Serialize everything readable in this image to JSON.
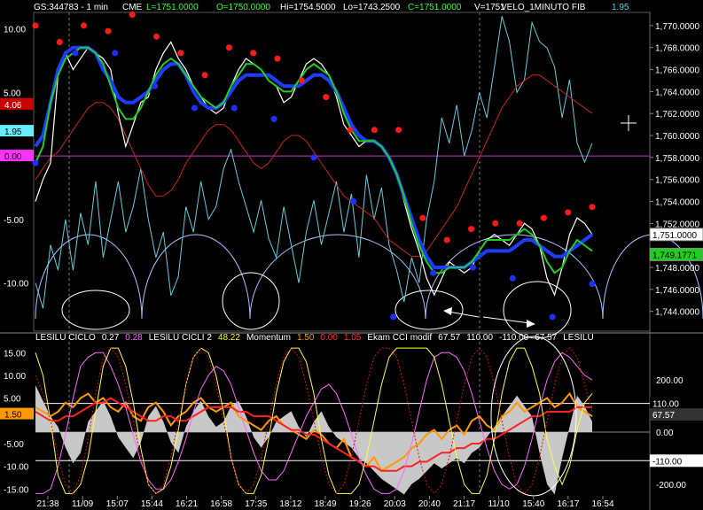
{
  "header": {
    "symbol": "GS:344783 - 1 min",
    "exchange": "CME",
    "last": "L=1751.0000",
    "open": "O=1750.0000",
    "high": "Hi=1754.5000",
    "low": "Lo=1743.2500",
    "close": "C=1751.0000",
    "volume": "V=1751",
    "study": "VELO_1MINUTO FIB",
    "study_value": "1.95"
  },
  "lower_header": [
    {
      "text": "LESILU CICLO",
      "color": "#ffffff"
    },
    {
      "text": "0.27",
      "color": "#ffffff"
    },
    {
      "text": "0.28",
      "color": "#ff66ff"
    },
    {
      "text": "LESILU CICLI 2",
      "color": "#ffffff"
    },
    {
      "text": "48.22",
      "color": "#ffff00"
    },
    {
      "text": "Momentum",
      "color": "#ffffff"
    },
    {
      "text": "1.50",
      "color": "#ff9900"
    },
    {
      "text": "0.00",
      "color": "#ff3333"
    },
    {
      "text": "1.05",
      "color": "#ff3333"
    },
    {
      "text": "Ekam CCI modif",
      "color": "#ffffff"
    },
    {
      "text": "67.57",
      "color": "#ffffff"
    },
    {
      "text": "110.00",
      "color": "#ffffff"
    },
    {
      "text": "-110.00",
      "color": "#ffffff"
    },
    {
      "text": "67.57",
      "color": "#ffffff"
    },
    {
      "text": "LESILU",
      "color": "#ffffff"
    }
  ],
  "colors": {
    "background": "#000000",
    "price": "#ffffff",
    "velocity": "#66ccdd",
    "ma_blue": "#1e3cff",
    "ma_green": "#22cc22",
    "ma_red": "#cc2222",
    "top_dot": "#ff1a1a",
    "bottom_dot": "#1f2fff",
    "cycle_arc": "#aac4ff",
    "zero_line": "#cc33cc"
  },
  "chart_data": [
    {
      "type": "line",
      "panel": "price",
      "y_left_ticks": [
        "10.00",
        "5.00",
        "-5.00",
        "-10.00"
      ],
      "y_right_ticks": [
        "1,770.0000",
        "1,768.0000",
        "1,766.0000",
        "1,764.0000",
        "1,762.0000",
        "1,760.0000",
        "1,758.0000",
        "1,756.0000",
        "1,754.0000",
        "1,752.0000",
        "1,748.0000",
        "1,746.0000",
        "1,744.0000"
      ],
      "ylim_price": [
        1742.2,
        1771.2
      ],
      "ylim_osc": [
        -13.8,
        11.3
      ],
      "left_markers": [
        {
          "text": "4.06",
          "bg": "#cc0000",
          "fg": "#ffffff",
          "value": 4.06
        },
        {
          "text": "1.95",
          "bg": "#66eeff",
          "fg": "#000000",
          "value": 1.95
        },
        {
          "text": "0.00",
          "bg": "#ff33ff",
          "fg": "#000000",
          "value": 0.0
        }
      ],
      "right_markers": [
        {
          "text": "1,751.0000",
          "bg": "#ffffff",
          "fg": "#000000",
          "value": 1751.0
        },
        {
          "text": "1,749.1771",
          "bg": "#22cc22",
          "fg": "#000000",
          "value": 1749.1771
        }
      ],
      "price_series": [
        1754.0,
        1756.0,
        1757.5,
        1765.5,
        1767.5,
        1766.0,
        1767.0,
        1768.0,
        1767.5,
        1767.0,
        1766.0,
        1762.0,
        1759.0,
        1761.0,
        1763.0,
        1763.5,
        1766.0,
        1767.5,
        1768.5,
        1767.0,
        1766.0,
        1764.5,
        1763.5,
        1762.5,
        1762.0,
        1762.5,
        1764.5,
        1766.0,
        1767.0,
        1766.5,
        1766.0,
        1765.0,
        1764.5,
        1763.0,
        1763.5,
        1765.0,
        1766.5,
        1767.0,
        1766.5,
        1765.5,
        1763.5,
        1761.0,
        1760.0,
        1759.0,
        1759.5,
        1759.5,
        1759.0,
        1758.0,
        1756.5,
        1754.0,
        1751.5,
        1749.5,
        1747.0,
        1745.5,
        1747.0,
        1748.5,
        1748.0,
        1747.5,
        1748.0,
        1749.5,
        1750.5,
        1751.0,
        1750.5,
        1750.0,
        1751.0,
        1752.0,
        1751.5,
        1750.0,
        1747.0,
        1745.5,
        1748.0,
        1751.0,
        1752.5,
        1752.0,
        1751.0
      ],
      "series": [
        {
          "color": "#1e3cff",
          "values": [
            1759.0,
            1760.0,
            1763.0,
            1766.0,
            1767.5,
            1768.0,
            1768.0,
            1768.0,
            1767.5,
            1766.0,
            1765.0,
            1763.5,
            1763.0,
            1763.0,
            1763.5,
            1764.0,
            1765.0,
            1766.0,
            1766.5,
            1766.5,
            1765.5,
            1764.0,
            1763.0,
            1762.5,
            1762.5,
            1763.0,
            1764.0,
            1765.0,
            1765.5,
            1765.5,
            1765.5,
            1765.5,
            1765.0,
            1764.5,
            1764.5,
            1764.5,
            1765.0,
            1765.5,
            1765.5,
            1765.0,
            1764.0,
            1762.5,
            1761.0,
            1760.0,
            1759.5,
            1759.5,
            1759.0,
            1758.0,
            1756.5,
            1754.5,
            1752.5,
            1750.5,
            1749.0,
            1748.0,
            1748.0,
            1748.0,
            1748.0,
            1748.0,
            1748.5,
            1749.0,
            1749.5,
            1749.5,
            1749.5,
            1749.5,
            1750.0,
            1750.5,
            1750.5,
            1750.0,
            1749.5,
            1749.0,
            1749.0,
            1749.5,
            1750.0,
            1750.5,
            1751.0
          ]
        },
        {
          "color": "#22cc22",
          "values": [
            1757.5,
            1759.0,
            1763.0,
            1765.5,
            1767.0,
            1767.5,
            1768.0,
            1768.0,
            1767.5,
            1766.5,
            1764.5,
            1762.5,
            1761.5,
            1761.5,
            1762.5,
            1764.0,
            1765.5,
            1766.5,
            1767.0,
            1766.5,
            1765.5,
            1764.5,
            1763.5,
            1763.0,
            1762.5,
            1763.0,
            1764.5,
            1765.5,
            1766.5,
            1766.5,
            1766.0,
            1765.0,
            1764.5,
            1764.0,
            1764.0,
            1765.0,
            1766.0,
            1766.5,
            1766.0,
            1765.5,
            1764.0,
            1762.0,
            1760.5,
            1759.5,
            1759.5,
            1759.5,
            1759.0,
            1758.0,
            1756.5,
            1754.5,
            1752.0,
            1750.0,
            1748.5,
            1747.5,
            1747.5,
            1748.0,
            1748.0,
            1748.0,
            1748.5,
            1749.5,
            1750.5,
            1750.5,
            1750.5,
            1750.5,
            1751.0,
            1751.5,
            1751.0,
            1750.0,
            1748.5,
            1747.5,
            1748.0,
            1749.5,
            1750.5,
            1750.0,
            1749.5
          ]
        },
        {
          "color": "#cc2222",
          "values": [
            1756.0,
            1757.0,
            1758.0,
            1758.5,
            1759.5,
            1760.5,
            1761.5,
            1762.5,
            1763.0,
            1763.0,
            1762.5,
            1761.5,
            1760.0,
            1758.5,
            1757.0,
            1755.5,
            1754.5,
            1754.5,
            1755.0,
            1756.0,
            1757.5,
            1758.5,
            1759.5,
            1760.5,
            1761.0,
            1761.0,
            1760.5,
            1759.5,
            1758.5,
            1757.5,
            1757.0,
            1757.5,
            1758.5,
            1759.5,
            1760.0,
            1760.0,
            1759.5,
            1758.5,
            1757.5,
            1756.5,
            1755.5,
            1754.5,
            1754.0,
            1753.5,
            1753.0,
            1752.5,
            1751.5,
            1750.5,
            1750.0,
            1749.5,
            1749.0,
            1749.0,
            1749.5,
            1750.5,
            1751.5,
            1752.5,
            1753.5,
            1755.0,
            1756.5,
            1758.0,
            1759.5,
            1761.0,
            1762.5,
            1763.5,
            1764.5,
            1765.0,
            1765.5,
            1765.5,
            1765.0,
            1764.5,
            1764.0,
            1763.5,
            1763.0,
            1762.5,
            1762.0
          ]
        },
        {
          "color": "#66ccdd",
          "values": [
            -10.0,
            -12.0,
            -7.0,
            -9.0,
            -5.0,
            -9.0,
            -4.5,
            -7.0,
            -2.0,
            -8.0,
            -5.0,
            -2.0,
            -6.0,
            -4.0,
            -1.0,
            -5.0,
            -8.0,
            -6.0,
            -11.0,
            -9.5,
            -4.0,
            -6.0,
            -2.0,
            -5.0,
            -4.0,
            -1.0,
            0.5,
            -2.0,
            -4.0,
            -6.0,
            -3.5,
            -6.5,
            -8.0,
            -4.0,
            -7.0,
            -10.0,
            -6.0,
            -3.5,
            -7.0,
            -4.5,
            -2.0,
            -6.0,
            -3.0,
            -8.0,
            -1.5,
            -5.0,
            -2.5,
            -7.0,
            -9.0,
            -11.5,
            -8.0,
            -10.0,
            -5.0,
            -2.0,
            3.0,
            1.0,
            4.0,
            0.0,
            2.0,
            5.0,
            3.0,
            7.0,
            11.0,
            9.0,
            5.0,
            6.0,
            10.5,
            9.0,
            8.5,
            7.0,
            3.0,
            6.0,
            1.0,
            -0.5,
            1.0
          ]
        }
      ],
      "top_dots": [
        1770.0,
        1768.5,
        1770.0,
        1769.5,
        1771.0,
        1769.0,
        1767.5,
        1765.5,
        1768.0,
        1767.5,
        1767.0,
        1765.0,
        1763.5,
        1760.5,
        1760.5,
        1760.5,
        1752.5,
        1750.5,
        1751.5,
        1752.0,
        1752.0,
        1752.5,
        1753.0,
        1753.5
      ],
      "bottom_dots": [
        1757.5,
        1767.5,
        1767.5,
        1764.5,
        1762.5,
        1762.5,
        1761.5,
        1758.0,
        1754.0,
        1743.5,
        1747.5,
        1748.0,
        1747.0,
        1743.5,
        1746.5
      ],
      "x_ticks": []
    },
    {
      "type": "line",
      "panel": "oscillator",
      "y_left_ticks": [
        "15.00",
        "10.00",
        "5.00",
        "-5.00",
        "-10.00",
        "-15.00"
      ],
      "y_right_ticks": [
        "200.00",
        "100.00",
        "0.00",
        "-200.00"
      ],
      "ylim_mom": [
        -16.5,
        17.0
      ],
      "ylim_cci": [
        -245,
        340
      ],
      "left_markers": [
        {
          "text": "1.50",
          "bg": "#ff9900",
          "fg": "#000000",
          "value": 1.5
        }
      ],
      "right_markers": [
        {
          "text": "110.00",
          "bg": "#000000",
          "fg": "#ffffff",
          "value": 110
        },
        {
          "text": "67.57",
          "bg": "#333333",
          "fg": "#ffffff",
          "value": 67.57
        },
        {
          "text": "-110.00",
          "bg": "#ffffff",
          "fg": "#000000",
          "value": -110
        }
      ],
      "x_ticks": [
        "21:38",
        "11/09",
        "15:07",
        "15:44",
        "16:21",
        "16:58",
        "17:35",
        "18:12",
        "18:49",
        "19:26",
        "20:03",
        "20:40",
        "21:17",
        "11/10",
        "15:40",
        "16:17",
        "16:54"
      ],
      "cci_area": [
        180,
        120,
        60,
        20,
        -60,
        -120,
        -80,
        40,
        80,
        120,
        60,
        -20,
        -60,
        -100,
        -40,
        60,
        100,
        40,
        -40,
        -80,
        20,
        80,
        120,
        60,
        20,
        40,
        100,
        120,
        60,
        -20,
        -60,
        -20,
        40,
        60,
        80,
        20,
        -20,
        40,
        80,
        20,
        -20,
        -40,
        -60,
        -100,
        -120,
        -150,
        -180,
        -200,
        -220,
        -240,
        -200,
        -180,
        -150,
        -120,
        -140,
        -120,
        -100,
        -120,
        -80,
        -60,
        -20,
        20,
        60,
        100,
        140,
        100,
        60,
        -80,
        -200,
        -240,
        -100,
        20,
        140,
        100,
        40
      ],
      "series": [
        {
          "name": "Momentum",
          "color": "#ff9900",
          "values": [
            3,
            2,
            1,
            2,
            4,
            3,
            5,
            6,
            4,
            5,
            3,
            2,
            4,
            1,
            0,
            3,
            4,
            2,
            -1,
            1,
            2,
            4,
            5,
            3,
            2,
            3,
            4,
            1,
            0,
            -1,
            -2,
            0,
            1,
            -1,
            -2,
            -3,
            -4,
            -2,
            -3,
            -5,
            -6,
            -4,
            -8,
            -9,
            -10,
            -8,
            -11,
            -10,
            -9,
            -8,
            -6,
            -5,
            -3,
            -2,
            -4,
            -2,
            -1,
            -3,
            0,
            1,
            -1,
            -2,
            1,
            2,
            4,
            2,
            3,
            4,
            5,
            3,
            4,
            6,
            3,
            2,
            1
          ]
        },
        {
          "name": "",
          "color": "#ff2020",
          "values": [
            2,
            1,
            0,
            0,
            1,
            1,
            2,
            3,
            4,
            4,
            5,
            4,
            3,
            2,
            1,
            0,
            0,
            1,
            1,
            0,
            0,
            1,
            2,
            3,
            3,
            3,
            3,
            2,
            2,
            1,
            1,
            1,
            0,
            -1,
            -2,
            -2,
            -3,
            -3,
            -4,
            -5,
            -6,
            -7,
            -8,
            -9,
            -10,
            -10,
            -11,
            -11,
            -11,
            -10,
            -10,
            -9,
            -9,
            -8,
            -7,
            -7,
            -6,
            -6,
            -5,
            -5,
            -4,
            -4,
            -3,
            -2,
            -1,
            0,
            1,
            1,
            2,
            2,
            2,
            2,
            3,
            3,
            3
          ]
        },
        {
          "name": "LESILU CICLO",
          "color": "#ff66ff",
          "values": [
            -16,
            -16,
            -15,
            -10,
            -3,
            5,
            12,
            14,
            15,
            15,
            12,
            8,
            3,
            -3,
            -9,
            -13,
            -15,
            -15,
            -13,
            -9,
            -4,
            2,
            7,
            10,
            12,
            11,
            8,
            3,
            -2,
            -7,
            -11,
            -13,
            -13,
            -11,
            -7,
            -3,
            1,
            4,
            7,
            8,
            6,
            2,
            -3,
            -8,
            -12,
            -15,
            -16,
            -16,
            -15,
            -11,
            -5,
            2,
            9,
            14,
            15,
            15,
            14,
            11,
            6,
            0,
            -6,
            -11,
            -14,
            -15,
            -14,
            -10,
            -4,
            3,
            9,
            13,
            15,
            14,
            12,
            10,
            9
          ]
        },
        {
          "name": "LESILU CICLI 2",
          "color": "#ffff44",
          "values": [
            15,
            10,
            0,
            -12,
            -16,
            -16,
            -14,
            -8,
            2,
            12,
            16,
            16,
            12,
            4,
            -6,
            -14,
            -16,
            -15,
            -10,
            -2,
            8,
            14,
            16,
            15,
            10,
            2,
            -8,
            -14,
            -16,
            -16,
            -12,
            -4,
            6,
            13,
            16,
            16,
            13,
            6,
            -4,
            -12,
            -16,
            -16,
            -16,
            -14,
            -8,
            0,
            8,
            14,
            16,
            16,
            16,
            16,
            16,
            14,
            8,
            0,
            -8,
            -14,
            -16,
            -16,
            -12,
            -4,
            6,
            13,
            16,
            16,
            12,
            6,
            -4,
            -10,
            -14,
            -10,
            -2,
            4,
            6
          ]
        },
        {
          "name": "",
          "color": "#cc1111",
          "values": [
            10,
            6,
            0,
            -8,
            -14,
            -16,
            -12,
            -4,
            6,
            14,
            16,
            14,
            8,
            0,
            -8,
            -14,
            -16,
            -14,
            -8,
            0,
            8,
            14,
            16,
            14,
            8,
            0,
            -8,
            -14,
            -16,
            -14,
            -8,
            0,
            8,
            14,
            16,
            14,
            8,
            0,
            -8,
            -14,
            -16,
            -14,
            -8,
            0,
            8,
            14,
            16,
            16,
            14,
            8,
            0,
            -8,
            -14,
            -16,
            -14,
            -8,
            0,
            8,
            14,
            16,
            14,
            8,
            0,
            -8,
            -14,
            -16,
            -14,
            -8,
            0,
            8,
            14,
            16,
            14,
            8,
            2
          ]
        }
      ]
    }
  ]
}
